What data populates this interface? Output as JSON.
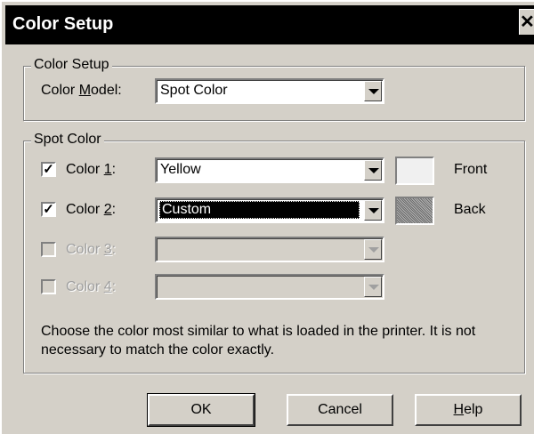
{
  "window": {
    "title": "Color Setup",
    "close_glyph": "✕"
  },
  "color_setup_group": {
    "legend": "Color Setup",
    "model_label_pre": "Color ",
    "model_label_u": "M",
    "model_label_post": "odel:",
    "model_value": "Spot Color"
  },
  "spot_color_group": {
    "legend": "Spot Color",
    "rows": [
      {
        "label_pre": "Color ",
        "label_u": "1",
        "label_post": ":",
        "checked": true,
        "enabled": true,
        "value": "Yellow",
        "side_label": "Front",
        "swatch": "front"
      },
      {
        "label_pre": "Color ",
        "label_u": "2",
        "label_post": ":",
        "checked": true,
        "enabled": true,
        "value": "Custom",
        "side_label": "Back",
        "swatch": "back"
      },
      {
        "label_pre": "Color ",
        "label_u": "3",
        "label_post": ":",
        "checked": false,
        "enabled": false,
        "value": ""
      },
      {
        "label_pre": "Color ",
        "label_u": "4",
        "label_post": ":",
        "checked": false,
        "enabled": false,
        "value": ""
      }
    ],
    "check_glyph": "✓",
    "note": "Choose the color most similar to what is loaded in the printer.  It is not necessary to match the color exactly."
  },
  "buttons": {
    "ok": "OK",
    "cancel": "Cancel",
    "help_u": "H",
    "help_post": "elp"
  },
  "colors": {
    "dialog_bg": "#d4d0c8",
    "titlebar_bg": "#000000",
    "selection_bg": "#000000"
  }
}
